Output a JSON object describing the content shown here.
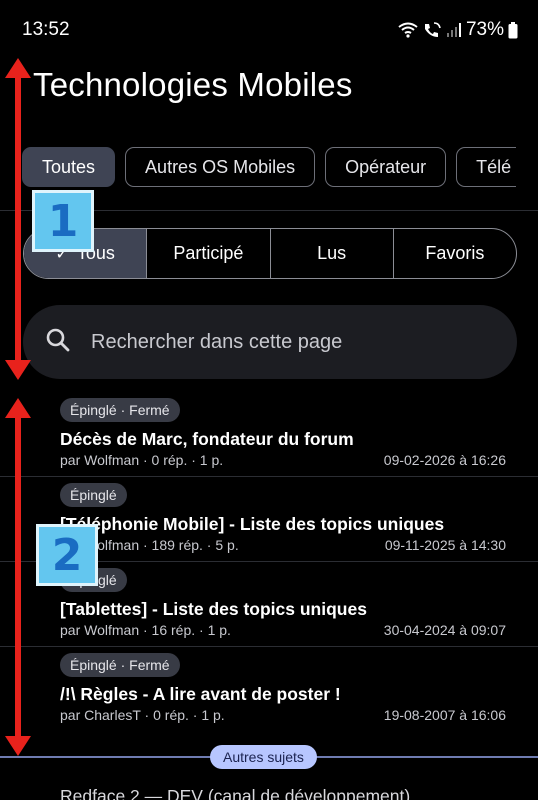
{
  "status": {
    "time": "13:52",
    "battery": "73%"
  },
  "page_title": "Technologies Mobiles",
  "categories": [
    "Toutes",
    "Autres OS Mobiles",
    "Opérateur",
    "Télé"
  ],
  "filters": [
    "Tous",
    "Participé",
    "Lus",
    "Favoris"
  ],
  "search": {
    "placeholder": "Rechercher dans cette page"
  },
  "topics": [
    {
      "badge": "Épinglé · Fermé",
      "title": "Décès de Marc, fondateur du forum",
      "meta": "par Wolfman · 0 rép. · 1 p.",
      "date": "09-02-2026 à 16:26"
    },
    {
      "badge": "Épinglé",
      "title": "[Téléphonie Mobile] - Liste des topics uniques",
      "meta": "par Wolfman · 189 rép. · 5 p.",
      "date": "09-11-2025 à 14:30"
    },
    {
      "badge": "Épinglé",
      "title": "[Tablettes] - Liste des topics uniques",
      "meta": "par Wolfman · 16 rép. · 1 p.",
      "date": "30-04-2024 à 09:07"
    },
    {
      "badge": "Épinglé · Fermé",
      "title": "/!\\ Règles - A lire avant de poster !",
      "meta": "par CharlesT · 0 rép. · 1 p.",
      "date": "19-08-2007 à 16:06"
    }
  ],
  "other_topics_label": "Autres sujets",
  "next_topic_title": "Redface 2 — DEV (canal de développement)",
  "annotations": [
    "1",
    "2"
  ],
  "colors": {
    "chip_selected": "#3f4454",
    "accent_badge": "#b7c6ff",
    "annotation_arrow": "#e8221c",
    "annotation_box": "#63c6ef"
  }
}
